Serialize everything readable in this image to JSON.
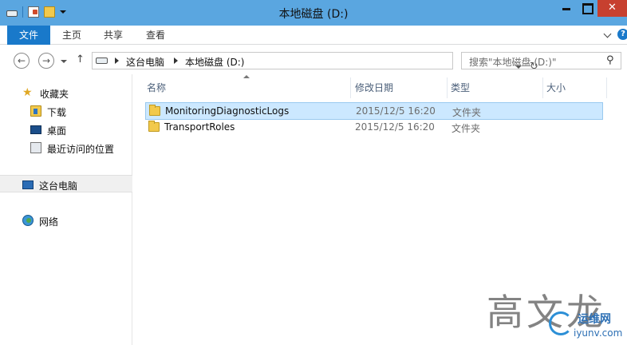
{
  "window": {
    "title": "本地磁盘 (D:)"
  },
  "ribbon": {
    "tabs": [
      "文件",
      "主页",
      "共享",
      "查看"
    ],
    "help_glyph": "?"
  },
  "address": {
    "crumbs": [
      "这台电脑",
      "本地磁盘 (D:)"
    ],
    "search_placeholder": "搜索\"本地磁盘 (D:)\""
  },
  "navpane": {
    "favorites_label": "收藏夹",
    "favorites": [
      "下载",
      "桌面",
      "最近访问的位置"
    ],
    "this_pc_label": "这台电脑",
    "network_label": "网络"
  },
  "columns": {
    "name": "名称",
    "date": "修改日期",
    "type": "类型",
    "size": "大小"
  },
  "files": [
    {
      "name": "MonitoringDiagnosticLogs",
      "date": "2015/12/5 16:20",
      "type": "文件夹",
      "selected": true
    },
    {
      "name": "TransportRoles",
      "date": "2015/12/5 16:20",
      "type": "文件夹",
      "selected": false
    }
  ],
  "watermark": {
    "big": "高文龙",
    "site": "运维网",
    "url": "iyunv.com"
  },
  "icons": {
    "title_drive": "drive-icon",
    "title_properties": "properties-icon",
    "title_new_folder": "new-folder-icon",
    "nav_back": "back-arrow-icon",
    "nav_forward": "forward-arrow-icon",
    "nav_up": "up-arrow-icon",
    "refresh": "refresh-icon",
    "search": "search-icon",
    "folder": "folder-icon",
    "star": "star-icon",
    "computer": "computer-icon",
    "network": "network-icon"
  },
  "colors": {
    "titlebar": "#5aa6e0",
    "file_tab": "#1979ca",
    "close_button": "#c7402f",
    "selection": "#cce8ff",
    "folder": "#f2c94c"
  }
}
